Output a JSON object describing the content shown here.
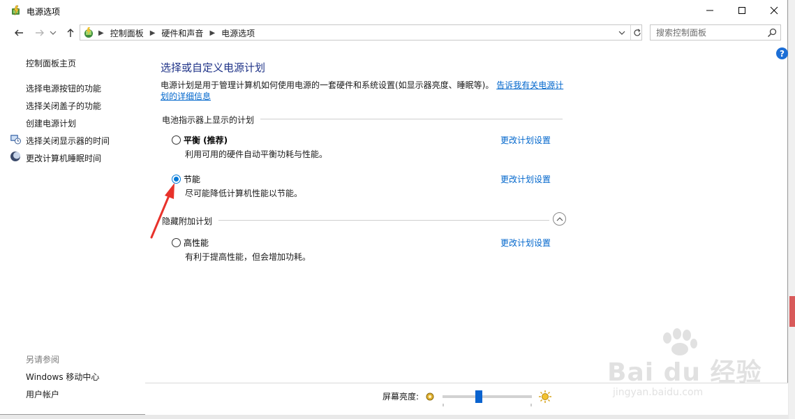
{
  "window": {
    "title": "电源选项"
  },
  "address_bar": {
    "crumbs": [
      "控制面板",
      "硬件和声音",
      "电源选项"
    ],
    "search_placeholder": "搜索控制面板"
  },
  "sidebar": {
    "items": [
      {
        "label": "控制面板主页"
      },
      {
        "label": "选择电源按钮的功能"
      },
      {
        "label": "选择关闭盖子的功能"
      },
      {
        "label": "创建电源计划"
      },
      {
        "label": "选择关闭显示器的时间"
      },
      {
        "label": "更改计算机睡眠时间"
      }
    ],
    "see_also": {
      "heading": "另请参阅",
      "items": [
        {
          "label": "Windows 移动中心"
        },
        {
          "label": "用户帐户"
        }
      ]
    }
  },
  "main": {
    "title": "选择或自定义电源计划",
    "description": "电源计划是用于管理计算机如何使用电源的一套硬件和系统设置(如显示器亮度、睡眠等)。",
    "description_link": "告诉我有关电源计划的详细信息",
    "battery_group_title": "电池指示器上显示的计划",
    "hidden_group_title": "隐藏附加计划",
    "plans": [
      {
        "name": "平衡 (推荐)",
        "desc": "利用可用的硬件自动平衡功耗与性能。",
        "link": "更改计划设置",
        "selected": false
      },
      {
        "name": "节能",
        "desc": "尽可能降低计算机性能以节能。",
        "link": "更改计划设置",
        "selected": true
      },
      {
        "name": "高性能",
        "desc": "有利于提高性能，但会增加功耗。",
        "link": "更改计划设置",
        "selected": false
      }
    ]
  },
  "bottom": {
    "brightness_label": "屏幕亮度:",
    "brightness_value": 0.4
  },
  "watermark": {
    "text": "Bai du 经验",
    "sub": "jingyan.baidu.com"
  },
  "colors": {
    "title_blue": "#1e3287",
    "link_blue": "#0066cc",
    "accent": "#0078d7",
    "annotation_red": "#e8322b"
  }
}
